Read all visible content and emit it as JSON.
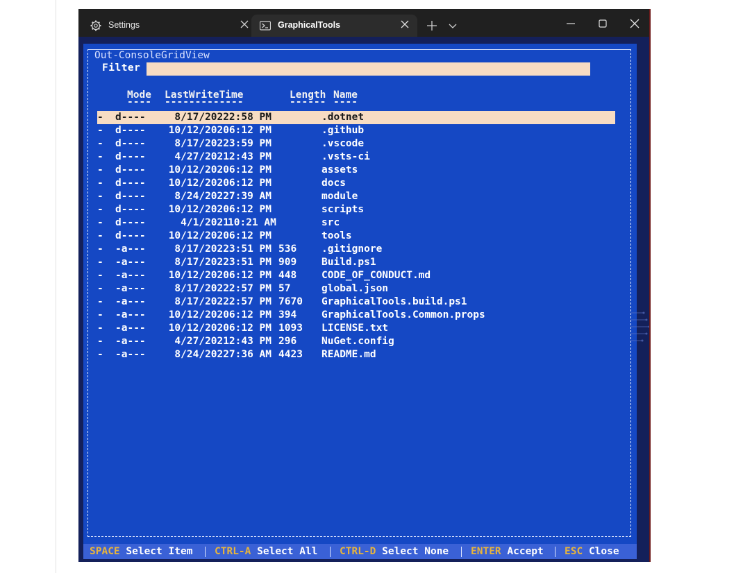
{
  "tabs": [
    {
      "label": "Settings",
      "icon": "gear-icon"
    },
    {
      "label": "GraphicalTools",
      "icon": "powershell-icon"
    }
  ],
  "window_controls": [
    "minimize",
    "maximize",
    "close"
  ],
  "grid": {
    "title": "Out-ConsoleGridView",
    "filter_label": "Filter",
    "filter_value": "",
    "headers": {
      "mode": "Mode",
      "last_write_time": "LastWriteTime",
      "length": "Length",
      "name": "Name"
    },
    "underlines": {
      "mode": "----",
      "last_write_time": "-------------",
      "length": "------",
      "name": "----"
    },
    "row_marker": "-",
    "selected_row": 0,
    "rows": [
      {
        "mode": "d----",
        "date": "8/17/2022",
        "time": "2:58 PM",
        "length": "",
        "name": ".dotnet"
      },
      {
        "mode": "d----",
        "date": "10/12/2020",
        "time": "6:12 PM",
        "length": "",
        "name": ".github"
      },
      {
        "mode": "d----",
        "date": "8/17/2022",
        "time": "3:59 PM",
        "length": "",
        "name": ".vscode"
      },
      {
        "mode": "d----",
        "date": "4/27/2021",
        "time": "2:43 PM",
        "length": "",
        "name": ".vsts-ci"
      },
      {
        "mode": "d----",
        "date": "10/12/2020",
        "time": "6:12 PM",
        "length": "",
        "name": "assets"
      },
      {
        "mode": "d----",
        "date": "10/12/2020",
        "time": "6:12 PM",
        "length": "",
        "name": "docs"
      },
      {
        "mode": "d----",
        "date": "8/24/2022",
        "time": "7:39 AM",
        "length": "",
        "name": "module"
      },
      {
        "mode": "d----",
        "date": "10/12/2020",
        "time": "6:12 PM",
        "length": "",
        "name": "scripts"
      },
      {
        "mode": "d----",
        "date": "4/1/2021",
        "time": "10:21 AM",
        "length": "",
        "name": "src"
      },
      {
        "mode": "d----",
        "date": "10/12/2020",
        "time": "6:12 PM",
        "length": "",
        "name": "tools"
      },
      {
        "mode": "-a---",
        "date": "8/17/2022",
        "time": "3:51 PM",
        "length": "536",
        "name": ".gitignore"
      },
      {
        "mode": "-a---",
        "date": "8/17/2022",
        "time": "3:51 PM",
        "length": "909",
        "name": "Build.ps1"
      },
      {
        "mode": "-a---",
        "date": "10/12/2020",
        "time": "6:12 PM",
        "length": "448",
        "name": "CODE_OF_CONDUCT.md"
      },
      {
        "mode": "-a---",
        "date": "8/17/2022",
        "time": "2:57 PM",
        "length": "57",
        "name": "global.json"
      },
      {
        "mode": "-a---",
        "date": "8/17/2022",
        "time": "2:57 PM",
        "length": "7670",
        "name": "GraphicalTools.build.ps1"
      },
      {
        "mode": "-a---",
        "date": "10/12/2020",
        "time": "6:12 PM",
        "length": "394",
        "name": "GraphicalTools.Common.props"
      },
      {
        "mode": "-a---",
        "date": "10/12/2020",
        "time": "6:12 PM",
        "length": "1093",
        "name": "LICENSE.txt"
      },
      {
        "mode": "-a---",
        "date": "4/27/2021",
        "time": "2:43 PM",
        "length": "296",
        "name": "NuGet.config"
      },
      {
        "mode": "-a---",
        "date": "8/24/2022",
        "time": "7:36 AM",
        "length": "4423",
        "name": "README.md"
      }
    ]
  },
  "statusbar": [
    {
      "key": "SPACE",
      "action": "Select Item"
    },
    {
      "key": "CTRL-A",
      "action": "Select All"
    },
    {
      "key": "CTRL-D",
      "action": "Select None"
    },
    {
      "key": "ENTER",
      "action": "Accept"
    },
    {
      "key": "ESC",
      "action": "Close"
    }
  ],
  "colors": {
    "terminal_background": "#1548c4",
    "selection_background": "#f7dcc3",
    "statusbar_background": "#3a61d6",
    "hotkey_color": "#e7b43c",
    "titlebar_background": "#202020"
  }
}
